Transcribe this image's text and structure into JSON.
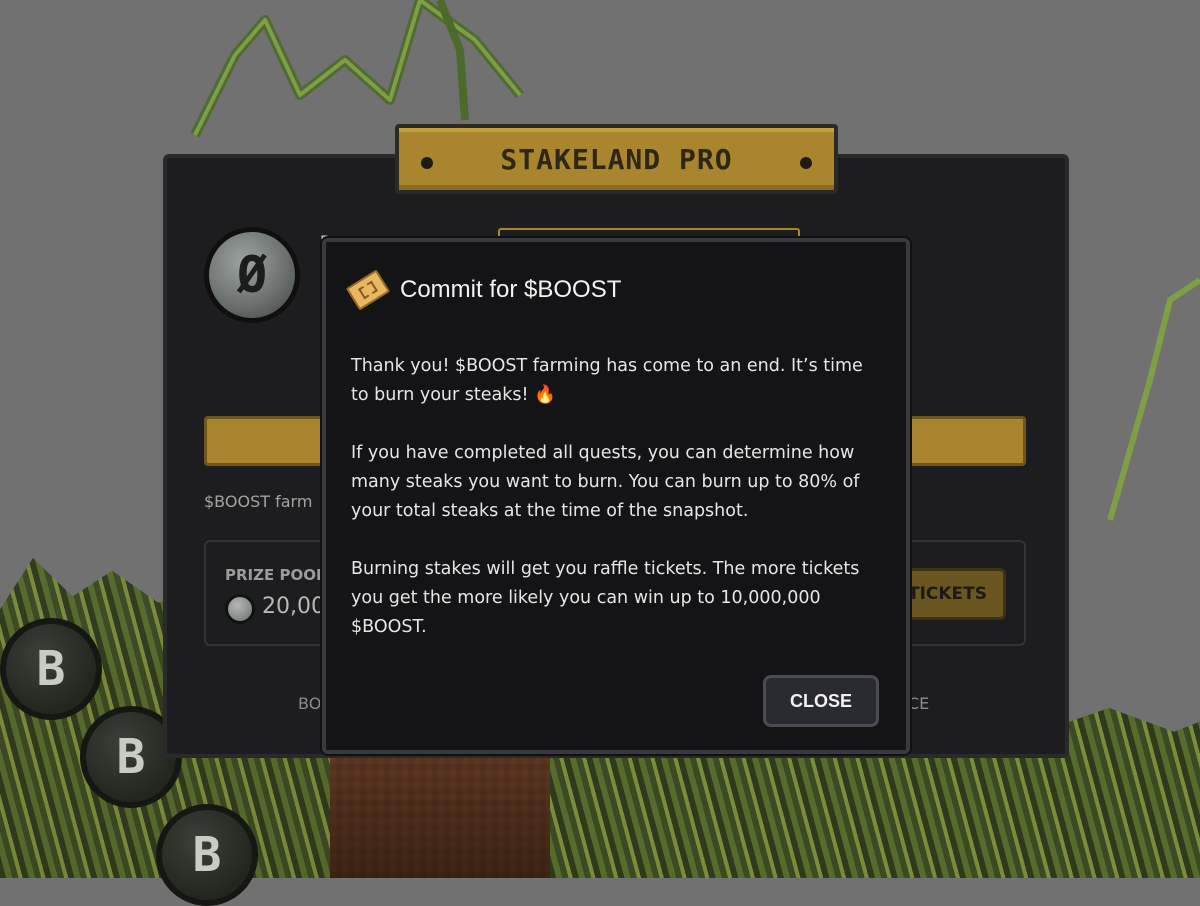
{
  "header": {
    "title": "STAKELAND PRO"
  },
  "profile": {
    "avatar_glyph": "Ø",
    "peek_label": "B"
  },
  "farm": {
    "text": "$BOOST farm"
  },
  "prize": {
    "label": "PRIZE POOL",
    "value": "20,00",
    "tickets_button": "T TICKETS"
  },
  "footer": {
    "left": "BO",
    "right": "CE"
  },
  "modal": {
    "title": "Commit for $BOOST",
    "icon": "ticket-icon",
    "paragraphs": [
      "Thank you! $BOOST farming has come to an end. It’s time to burn your steaks! 🔥",
      "If you have completed all quests, you can determine how many steaks you want to burn. You can burn up to 80% of your total steaks at the time of the snapshot.",
      "Burning stakes will get you raffle tickets. The more tickets you get the more likely you can win up to 10,000,000 $BOOST."
    ],
    "close_label": "CLOSE"
  },
  "background": {
    "coin_glyph": "B"
  },
  "colors": {
    "gold": "#a9862e",
    "card": "#1d1d1f",
    "modal": "#141417",
    "backdrop": "#717171"
  }
}
